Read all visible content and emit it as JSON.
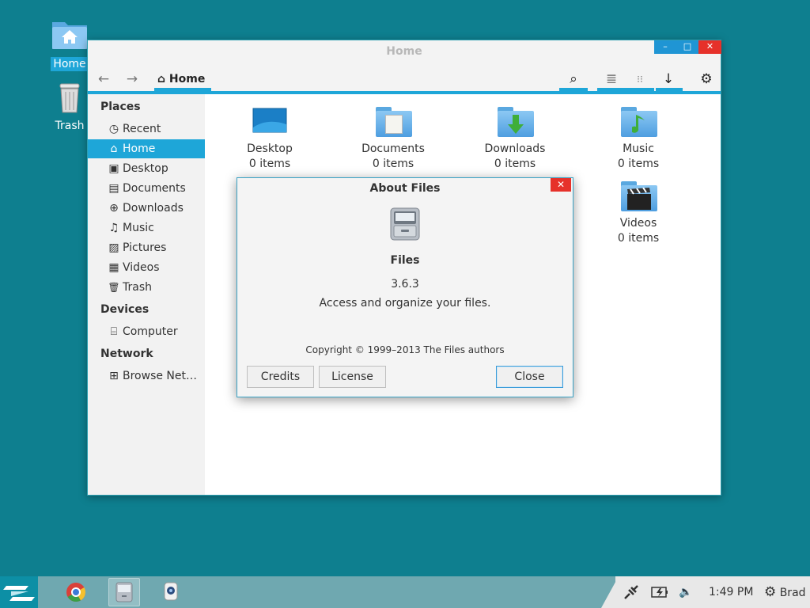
{
  "desktop": {
    "icons": [
      {
        "label": "Home",
        "icon": "home-folder-icon",
        "selected": true
      },
      {
        "label": "Trash",
        "icon": "trash-can-icon",
        "selected": false
      }
    ]
  },
  "window": {
    "title": "Home",
    "controls": {
      "minimize": "–",
      "maximize": "□",
      "close": "✕"
    }
  },
  "toolbar": {
    "back": "←",
    "forward": "→",
    "path_icon": "⌂",
    "path_label": "Home",
    "search": "⌕",
    "list_view": "≣",
    "grid_view": "⁝⁝",
    "download": "↓",
    "settings": "⚙"
  },
  "sidebar": {
    "places_header": "Places",
    "places": [
      {
        "label": "Recent",
        "icon": "◷"
      },
      {
        "label": "Home",
        "icon": "⌂"
      },
      {
        "label": "Desktop",
        "icon": "▣"
      },
      {
        "label": "Documents",
        "icon": "▤"
      },
      {
        "label": "Downloads",
        "icon": "⊕"
      },
      {
        "label": "Music",
        "icon": "♫"
      },
      {
        "label": "Pictures",
        "icon": "▨"
      },
      {
        "label": "Videos",
        "icon": "▦"
      },
      {
        "label": "Trash",
        "icon": "🗑"
      }
    ],
    "devices_header": "Devices",
    "devices": [
      {
        "label": "Computer",
        "icon": "⌸"
      }
    ],
    "network_header": "Network",
    "network": [
      {
        "label": "Browse Net…",
        "icon": "⊞"
      }
    ]
  },
  "files": [
    {
      "name": "Desktop",
      "count": "0 items"
    },
    {
      "name": "Documents",
      "count": "0 items"
    },
    {
      "name": "Downloads",
      "count": "0 items"
    },
    {
      "name": "Music",
      "count": "0 items"
    },
    {
      "name": "Videos",
      "count": "0 items"
    }
  ],
  "about": {
    "title": "About Files",
    "close": "✕",
    "app_name": "Files",
    "version": "3.6.3",
    "description": "Access and organize your files.",
    "copyright": "Copyright © 1999–2013 The Files authors",
    "buttons": {
      "credits": "Credits",
      "license": "License",
      "close": "Close"
    }
  },
  "taskbar": {
    "clock": "1:49 PM",
    "user": "Brad",
    "settings_glyph": "⚙",
    "volume_glyph": "🔈"
  },
  "colors": {
    "desktop_bg": "#0e7f8f",
    "accent": "#1ea6d8",
    "close_red": "#e6312a"
  }
}
